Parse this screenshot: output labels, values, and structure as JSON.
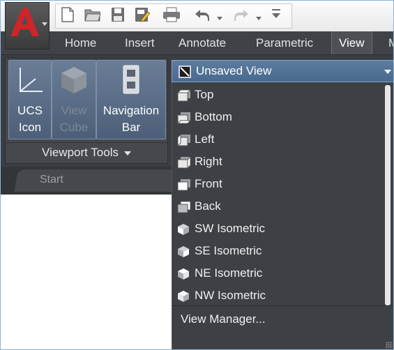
{
  "app": {
    "logo_letter": "A",
    "logo_color": "#d1232a"
  },
  "quick_access": {
    "icons": [
      "new-icon",
      "open-icon",
      "save-icon",
      "save-as-icon",
      "plot-icon",
      "undo-icon",
      "redo-icon",
      "customize-icon"
    ]
  },
  "ribbon_tabs": [
    {
      "label": "Home"
    },
    {
      "label": "Insert"
    },
    {
      "label": "Annotate"
    },
    {
      "label": "Parametric"
    },
    {
      "label": "View"
    },
    {
      "label": "M"
    }
  ],
  "active_tab": "View",
  "viewport_tools": {
    "panel_title": "Viewport Tools",
    "buttons": [
      {
        "label_line1": "UCS",
        "label_line2": "Icon",
        "icon": "ucs-icon"
      },
      {
        "label_line1": "View",
        "label_line2": "Cube",
        "icon": "view-cube-icon",
        "disabled": true
      },
      {
        "label_line1": "Navigation",
        "label_line2": "Bar",
        "icon": "navigation-bar-icon"
      }
    ]
  },
  "file_tabs": {
    "start_label": "Start"
  },
  "view_dropdown": {
    "selected": "Unsaved View",
    "items": [
      {
        "label": "Top",
        "icon": "top-view-icon"
      },
      {
        "label": "Bottom",
        "icon": "bottom-view-icon"
      },
      {
        "label": "Left",
        "icon": "left-view-icon"
      },
      {
        "label": "Right",
        "icon": "right-view-icon"
      },
      {
        "label": "Front",
        "icon": "front-view-icon"
      },
      {
        "label": "Back",
        "icon": "back-view-icon"
      },
      {
        "label": "SW Isometric",
        "icon": "sw-isometric-icon"
      },
      {
        "label": "SE Isometric",
        "icon": "se-isometric-icon"
      },
      {
        "label": "NE Isometric",
        "icon": "ne-isometric-icon"
      },
      {
        "label": "NW Isometric",
        "icon": "nw-isometric-icon"
      }
    ],
    "manager_label": "View Manager..."
  },
  "colors": {
    "ribbon_dark": "#3a3d42",
    "accent_blue": "#486a8f",
    "logo_red": "#d1232a"
  }
}
